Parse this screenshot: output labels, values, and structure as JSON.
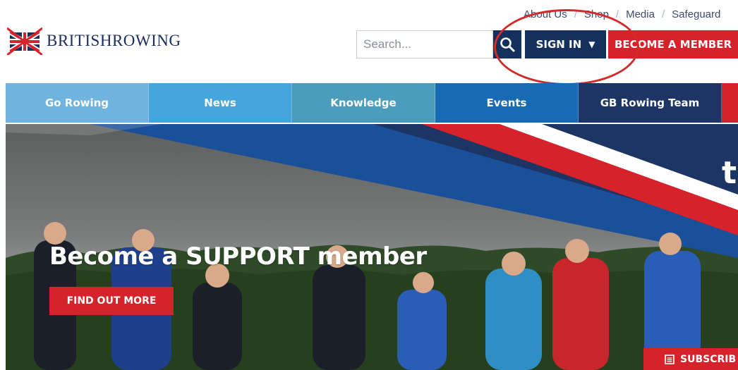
{
  "header": {
    "logo_text_first": "BRITISH",
    "logo_text_second": "ROWING",
    "utility_nav": [
      "About Us",
      "Shop",
      "Media",
      "Safeguard"
    ],
    "search_placeholder": "Search...",
    "sign_in_label": "SIGN IN",
    "sign_in_caret": "▼",
    "become_member_label": "BECOME A MEMBER"
  },
  "main_nav": {
    "items": [
      "Go Rowing",
      "News",
      "Knowledge",
      "Events",
      "GB Rowing Team"
    ]
  },
  "hero": {
    "title": "Become a SUPPORT member",
    "button_label": "FIND OUT MORE",
    "partial_text": "t",
    "subscribe_label": "SUBSCRIB"
  },
  "colors": {
    "navy": "#14305c",
    "red": "#d6222a"
  },
  "icons": {
    "logo": "union-jack-oars-icon",
    "search": "search-icon",
    "subscribe": "newsletter-icon"
  }
}
